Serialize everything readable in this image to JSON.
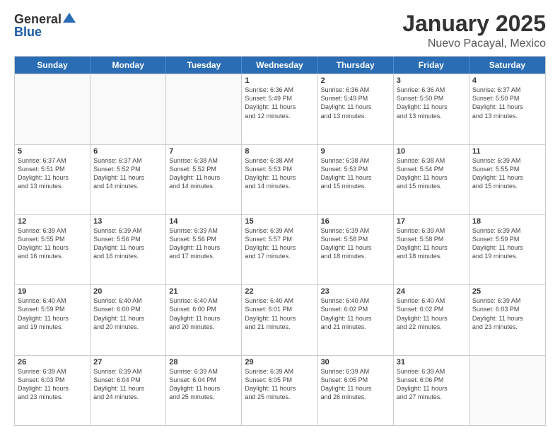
{
  "logo": {
    "general": "General",
    "blue": "Blue"
  },
  "title": "January 2025",
  "subtitle": "Nuevo Pacayal, Mexico",
  "days_of_week": [
    "Sunday",
    "Monday",
    "Tuesday",
    "Wednesday",
    "Thursday",
    "Friday",
    "Saturday"
  ],
  "weeks": [
    [
      {
        "day": "",
        "info": ""
      },
      {
        "day": "",
        "info": ""
      },
      {
        "day": "",
        "info": ""
      },
      {
        "day": "1",
        "info": "Sunrise: 6:36 AM\nSunset: 5:49 PM\nDaylight: 11 hours\nand 12 minutes."
      },
      {
        "day": "2",
        "info": "Sunrise: 6:36 AM\nSunset: 5:49 PM\nDaylight: 11 hours\nand 13 minutes."
      },
      {
        "day": "3",
        "info": "Sunrise: 6:36 AM\nSunset: 5:50 PM\nDaylight: 11 hours\nand 13 minutes."
      },
      {
        "day": "4",
        "info": "Sunrise: 6:37 AM\nSunset: 5:50 PM\nDaylight: 11 hours\nand 13 minutes."
      }
    ],
    [
      {
        "day": "5",
        "info": "Sunrise: 6:37 AM\nSunset: 5:51 PM\nDaylight: 11 hours\nand 13 minutes."
      },
      {
        "day": "6",
        "info": "Sunrise: 6:37 AM\nSunset: 5:52 PM\nDaylight: 11 hours\nand 14 minutes."
      },
      {
        "day": "7",
        "info": "Sunrise: 6:38 AM\nSunset: 5:52 PM\nDaylight: 11 hours\nand 14 minutes."
      },
      {
        "day": "8",
        "info": "Sunrise: 6:38 AM\nSunset: 5:53 PM\nDaylight: 11 hours\nand 14 minutes."
      },
      {
        "day": "9",
        "info": "Sunrise: 6:38 AM\nSunset: 5:53 PM\nDaylight: 11 hours\nand 15 minutes."
      },
      {
        "day": "10",
        "info": "Sunrise: 6:38 AM\nSunset: 5:54 PM\nDaylight: 11 hours\nand 15 minutes."
      },
      {
        "day": "11",
        "info": "Sunrise: 6:39 AM\nSunset: 5:55 PM\nDaylight: 11 hours\nand 15 minutes."
      }
    ],
    [
      {
        "day": "12",
        "info": "Sunrise: 6:39 AM\nSunset: 5:55 PM\nDaylight: 11 hours\nand 16 minutes."
      },
      {
        "day": "13",
        "info": "Sunrise: 6:39 AM\nSunset: 5:56 PM\nDaylight: 11 hours\nand 16 minutes."
      },
      {
        "day": "14",
        "info": "Sunrise: 6:39 AM\nSunset: 5:56 PM\nDaylight: 11 hours\nand 17 minutes."
      },
      {
        "day": "15",
        "info": "Sunrise: 6:39 AM\nSunset: 5:57 PM\nDaylight: 11 hours\nand 17 minutes."
      },
      {
        "day": "16",
        "info": "Sunrise: 6:39 AM\nSunset: 5:58 PM\nDaylight: 11 hours\nand 18 minutes."
      },
      {
        "day": "17",
        "info": "Sunrise: 6:39 AM\nSunset: 5:58 PM\nDaylight: 11 hours\nand 18 minutes."
      },
      {
        "day": "18",
        "info": "Sunrise: 6:39 AM\nSunset: 5:59 PM\nDaylight: 11 hours\nand 19 minutes."
      }
    ],
    [
      {
        "day": "19",
        "info": "Sunrise: 6:40 AM\nSunset: 5:59 PM\nDaylight: 11 hours\nand 19 minutes."
      },
      {
        "day": "20",
        "info": "Sunrise: 6:40 AM\nSunset: 6:00 PM\nDaylight: 11 hours\nand 20 minutes."
      },
      {
        "day": "21",
        "info": "Sunrise: 6:40 AM\nSunset: 6:00 PM\nDaylight: 11 hours\nand 20 minutes."
      },
      {
        "day": "22",
        "info": "Sunrise: 6:40 AM\nSunset: 6:01 PM\nDaylight: 11 hours\nand 21 minutes."
      },
      {
        "day": "23",
        "info": "Sunrise: 6:40 AM\nSunset: 6:02 PM\nDaylight: 11 hours\nand 21 minutes."
      },
      {
        "day": "24",
        "info": "Sunrise: 6:40 AM\nSunset: 6:02 PM\nDaylight: 11 hours\nand 22 minutes."
      },
      {
        "day": "25",
        "info": "Sunrise: 6:39 AM\nSunset: 6:03 PM\nDaylight: 11 hours\nand 23 minutes."
      }
    ],
    [
      {
        "day": "26",
        "info": "Sunrise: 6:39 AM\nSunset: 6:03 PM\nDaylight: 11 hours\nand 23 minutes."
      },
      {
        "day": "27",
        "info": "Sunrise: 6:39 AM\nSunset: 6:04 PM\nDaylight: 11 hours\nand 24 minutes."
      },
      {
        "day": "28",
        "info": "Sunrise: 6:39 AM\nSunset: 6:04 PM\nDaylight: 11 hours\nand 25 minutes."
      },
      {
        "day": "29",
        "info": "Sunrise: 6:39 AM\nSunset: 6:05 PM\nDaylight: 11 hours\nand 25 minutes."
      },
      {
        "day": "30",
        "info": "Sunrise: 6:39 AM\nSunset: 6:05 PM\nDaylight: 11 hours\nand 26 minutes."
      },
      {
        "day": "31",
        "info": "Sunrise: 6:39 AM\nSunset: 6:06 PM\nDaylight: 11 hours\nand 27 minutes."
      },
      {
        "day": "",
        "info": ""
      }
    ]
  ]
}
